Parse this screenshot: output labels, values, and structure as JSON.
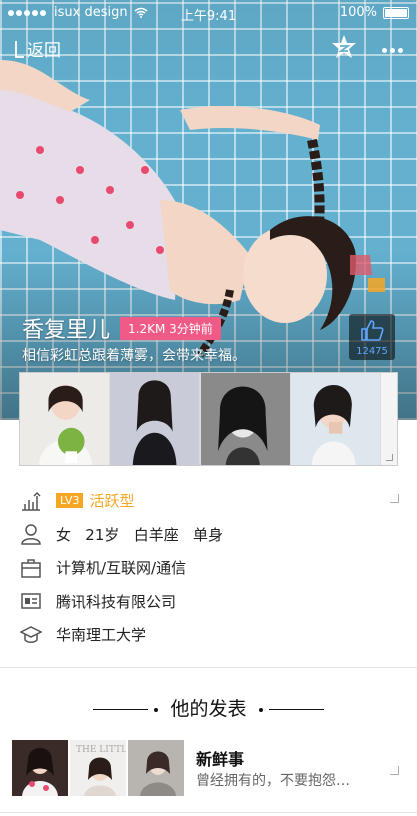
{
  "status": {
    "carrier": "isux design",
    "time": "上午9:41",
    "battery": "100%"
  },
  "nav": {
    "back_label": "返回"
  },
  "profile": {
    "name": "香复里儿",
    "distance_badge": "1.2KM 3分钟前",
    "tagline": "相信彩虹总跟着薄雾，会带来幸福。",
    "likes": "12475"
  },
  "info": {
    "level": "LV3",
    "activity": "活跃型",
    "basic": "女   21岁   白羊座   单身",
    "industry": "计算机/互联网/通信",
    "company": "腾讯科技有限公司",
    "school": "华南理工大学"
  },
  "posts": {
    "section_title": "他的发表",
    "item": {
      "title": "新鲜事",
      "text": "曾经拥有的，不要抱怨…",
      "thumb_text": "THE LITTLE"
    }
  },
  "colors": {
    "accent_orange": "#f5a623",
    "badge_pink": "#f05a87",
    "like_blue": "#5fa6ff"
  }
}
